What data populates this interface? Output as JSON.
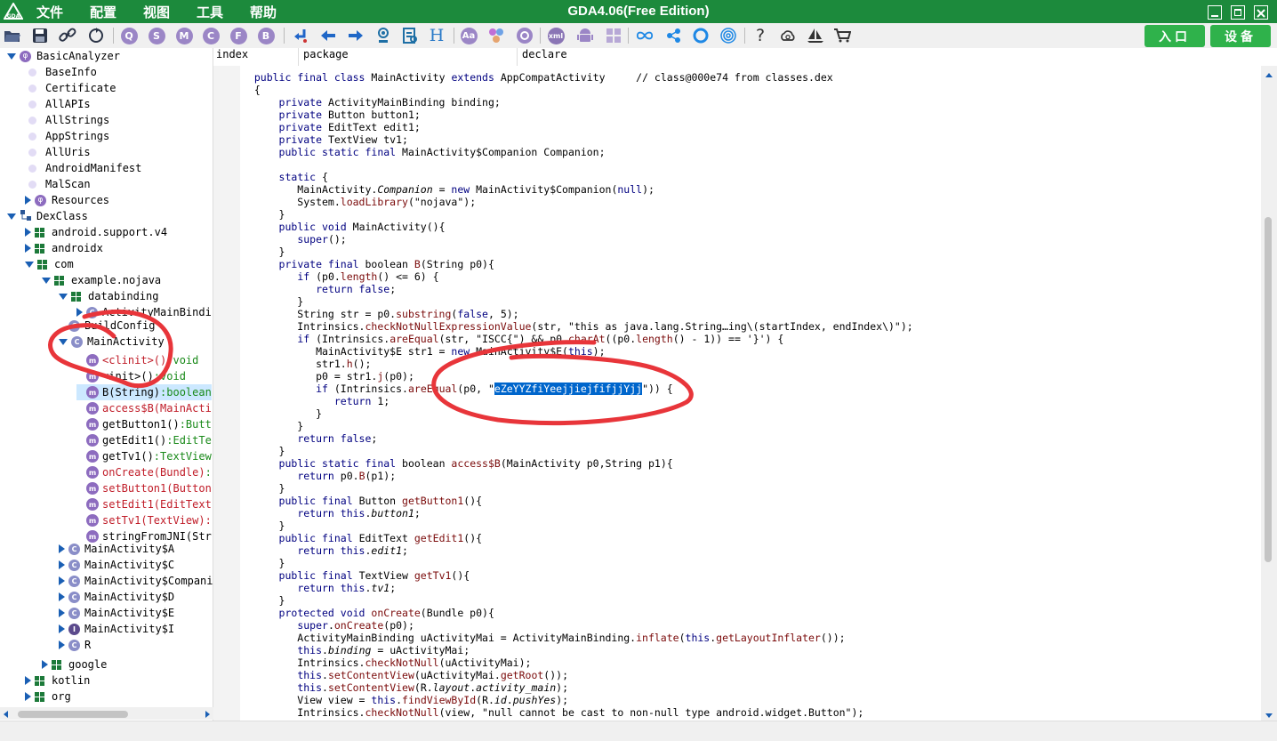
{
  "window": {
    "title": "GDA4.06(Free Edition)",
    "accent": "#1c8a3c"
  },
  "menu": [
    "文件",
    "配置",
    "视图",
    "工具",
    "帮助"
  ],
  "toolbar": {
    "circle_labels": [
      "Q",
      "S",
      "M",
      "C",
      "F",
      "B"
    ],
    "text_labels": [
      "H",
      "Aa",
      "xml",
      "?"
    ],
    "enter_button": "入口",
    "device_button": "设备",
    "button_color": "#2fb24b"
  },
  "tree": [
    {
      "label": "BasicAnalyzer",
      "icon": "analyzer-icon",
      "expander": "down",
      "depth": 0
    },
    {
      "label": "BaseInfo",
      "icon": "dot",
      "depth": 1
    },
    {
      "label": "Certificate",
      "icon": "dot",
      "depth": 1
    },
    {
      "label": "AllAPIs",
      "icon": "dot",
      "depth": 1
    },
    {
      "label": "AllStrings",
      "icon": "dot",
      "depth": 1
    },
    {
      "label": "AppStrings",
      "icon": "dot",
      "depth": 1
    },
    {
      "label": "AllUris",
      "icon": "dot",
      "depth": 1
    },
    {
      "label": "AndroidManifest",
      "icon": "dot",
      "depth": 1
    },
    {
      "label": "MalScan",
      "icon": "dot",
      "depth": 1
    },
    {
      "label": "Resources",
      "icon": "phi",
      "expander": "right",
      "depth": 1
    },
    {
      "label": "DexClass",
      "icon": "dex-icon",
      "expander": "down",
      "depth": 0
    },
    {
      "label": "android.support.v4",
      "icon": "pkg",
      "expander": "right",
      "depth": 1
    },
    {
      "label": "androidx",
      "icon": "pkg",
      "expander": "right",
      "depth": 1
    },
    {
      "label": "com",
      "icon": "pkg",
      "expander": "down",
      "depth": 1
    },
    {
      "label": "example.nojava",
      "icon": "pkg",
      "expander": "down",
      "depth": 2
    },
    {
      "label": "databinding",
      "icon": "pkg",
      "expander": "down",
      "depth": 3
    },
    {
      "label": "ActivityMainBindi",
      "icon": "class",
      "expander": "right",
      "depth": 4
    },
    {
      "label": "BuildConfig",
      "icon": "class",
      "depth": 3
    },
    {
      "label": "MainActivity",
      "icon": "class",
      "expander": "down",
      "depth": 3
    },
    {
      "label": "<clinit>()",
      "ret": ":void",
      "ret_color": "green",
      "icon": "method",
      "depth": 4
    },
    {
      "label": "<init>()",
      "ret": ":void",
      "ret_color": "green",
      "icon": "method",
      "depth": 4
    },
    {
      "label": "B(String)",
      "ret": ":boolean",
      "ret_color": "green",
      "icon": "method",
      "depth": 4,
      "selected": true
    },
    {
      "label": "access$B(MainActi",
      "ret": "",
      "ret_color": "red",
      "icon": "method",
      "depth": 4
    },
    {
      "label": "getButton1()",
      "ret": ":Butt",
      "ret_color": "green",
      "icon": "method",
      "depth": 4
    },
    {
      "label": "getEdit1()",
      "ret": ":EditTe",
      "ret_color": "green",
      "icon": "method",
      "depth": 4
    },
    {
      "label": "getTv1()",
      "ret": ":TextView",
      "ret_color": "green",
      "icon": "method",
      "depth": 4
    },
    {
      "label": "onCreate(Bundle)",
      "ret": ":",
      "ret_color": "green",
      "icon": "method",
      "depth": 4
    },
    {
      "label": "setButton1(Button",
      "ret": "",
      "ret_color": "red",
      "icon": "method",
      "depth": 4
    },
    {
      "label": "setEdit1(EditText",
      "ret": "",
      "ret_color": "red",
      "icon": "method",
      "depth": 4
    },
    {
      "label": "setTv1(TextView)",
      "ret": ":",
      "ret_color": "red",
      "icon": "method",
      "depth": 4
    },
    {
      "label": "stringFromJNI(Str",
      "ret": "",
      "ret_color": "green",
      "icon": "method",
      "depth": 4
    },
    {
      "label": "MainActivity$A",
      "icon": "class",
      "expander": "right",
      "depth": 3
    },
    {
      "label": "MainActivity$C",
      "icon": "class",
      "expander": "right",
      "depth": 3
    },
    {
      "label": "MainActivity$Compani",
      "icon": "class",
      "expander": "right",
      "depth": 3
    },
    {
      "label": "MainActivity$D",
      "icon": "class",
      "expander": "right",
      "depth": 3
    },
    {
      "label": "MainActivity$E",
      "icon": "class",
      "expander": "right",
      "depth": 3
    },
    {
      "label": "MainActivity$I",
      "icon": "interface",
      "expander": "right",
      "depth": 3
    },
    {
      "label": "R",
      "icon": "class",
      "expander": "right",
      "depth": 3
    },
    {
      "label": "google",
      "icon": "pkg",
      "expander": "right",
      "depth": 2
    },
    {
      "label": "kotlin",
      "icon": "pkg",
      "expander": "right",
      "depth": 1
    },
    {
      "label": "org",
      "icon": "pkg",
      "expander": "right",
      "depth": 1
    }
  ],
  "code_columns": [
    "index",
    "package",
    "declare"
  ],
  "code": [
    [
      [
        "  ",
        ""
      ],
      [
        "public final class ",
        "kw"
      ],
      [
        "MainActivity ",
        ""
      ],
      [
        "extends ",
        "kw"
      ],
      [
        "AppCompatActivity     // class@000e74 from classes.dex",
        ""
      ]
    ],
    [
      [
        "  {",
        ""
      ]
    ],
    [
      [
        "      ",
        ""
      ],
      [
        "private ",
        "kw"
      ],
      [
        "ActivityMainBinding binding;",
        ""
      ]
    ],
    [
      [
        "      ",
        ""
      ],
      [
        "private ",
        "kw"
      ],
      [
        "Button button1;",
        ""
      ]
    ],
    [
      [
        "      ",
        ""
      ],
      [
        "private ",
        "kw"
      ],
      [
        "EditText edit1;",
        ""
      ]
    ],
    [
      [
        "      ",
        ""
      ],
      [
        "private ",
        "kw"
      ],
      [
        "TextView tv1;",
        ""
      ]
    ],
    [
      [
        "      ",
        ""
      ],
      [
        "public static final ",
        "kw"
      ],
      [
        "MainActivity$Companion Companion;",
        ""
      ]
    ],
    [
      [
        "",
        ""
      ]
    ],
    [
      [
        "      ",
        ""
      ],
      [
        "static ",
        "kw"
      ],
      [
        "{",
        ""
      ]
    ],
    [
      [
        "         MainActivity.",
        ""
      ],
      [
        "Companion",
        "it"
      ],
      [
        " = ",
        ""
      ],
      [
        "new ",
        "kw"
      ],
      [
        "MainActivity$Companion(",
        ""
      ],
      [
        "null",
        "kw"
      ],
      [
        ");",
        ""
      ]
    ],
    [
      [
        "         System.",
        ""
      ],
      [
        "loadLibrary",
        "fn"
      ],
      [
        "(\"nojava\");",
        ""
      ]
    ],
    [
      [
        "      }",
        ""
      ]
    ],
    [
      [
        "      ",
        ""
      ],
      [
        "public void ",
        "kw"
      ],
      [
        "MainActivity(){",
        ""
      ]
    ],
    [
      [
        "         ",
        ""
      ],
      [
        "super",
        "kw"
      ],
      [
        "();",
        ""
      ]
    ],
    [
      [
        "      }",
        ""
      ]
    ],
    [
      [
        "      ",
        ""
      ],
      [
        "private final ",
        "kw"
      ],
      [
        "boolean ",
        ""
      ],
      [
        "B",
        "fn"
      ],
      [
        "(String p0){",
        ""
      ]
    ],
    [
      [
        "         ",
        ""
      ],
      [
        "if ",
        "kw"
      ],
      [
        "(p0.",
        ""
      ],
      [
        "length",
        "fn"
      ],
      [
        "() <= 6) {",
        ""
      ]
    ],
    [
      [
        "            ",
        ""
      ],
      [
        "return false",
        "kw"
      ],
      [
        ";",
        ""
      ]
    ],
    [
      [
        "         }",
        ""
      ]
    ],
    [
      [
        "         String str = p0.",
        ""
      ],
      [
        "substring",
        "fn"
      ],
      [
        "(",
        ""
      ],
      [
        "false",
        "kw"
      ],
      [
        ", 5);",
        ""
      ]
    ],
    [
      [
        "         Intrinsics.",
        ""
      ],
      [
        "checkNotNullExpressionValue",
        "fn"
      ],
      [
        "(str, \"this as java.lang.String…ing\\(startIndex, endIndex\\)\");",
        ""
      ]
    ],
    [
      [
        "         ",
        ""
      ],
      [
        "if ",
        "kw"
      ],
      [
        "(Intrinsics.",
        ""
      ],
      [
        "areEqual",
        "fn"
      ],
      [
        "(str, \"ISCC{\") && p0.",
        ""
      ],
      [
        "charAt",
        "fn"
      ],
      [
        "((p0.",
        ""
      ],
      [
        "length",
        "fn"
      ],
      [
        "() - 1)) == '}') {",
        ""
      ]
    ],
    [
      [
        "            MainActivity$E str1 = ",
        ""
      ],
      [
        "new ",
        "kw"
      ],
      [
        "MainActivity$E(",
        ""
      ],
      [
        "this",
        "kw"
      ],
      [
        ");",
        ""
      ]
    ],
    [
      [
        "            str1.",
        ""
      ],
      [
        "h",
        "fn"
      ],
      [
        "();",
        ""
      ]
    ],
    [
      [
        "            p0 = str1.",
        ""
      ],
      [
        "j",
        "fn"
      ],
      [
        "(p0);",
        ""
      ]
    ],
    [
      [
        "            ",
        ""
      ],
      [
        "if ",
        "kw"
      ],
      [
        "(Intrinsics.",
        ""
      ],
      [
        "areEqual",
        "fn"
      ],
      [
        "(p0, \"",
        ""
      ],
      [
        "eZeYYZfiYeejjiejfifjjYjj",
        "hl"
      ],
      [
        "\")) {",
        ""
      ]
    ],
    [
      [
        "               ",
        ""
      ],
      [
        "return ",
        "kw"
      ],
      [
        "1;",
        ""
      ]
    ],
    [
      [
        "            }",
        ""
      ]
    ],
    [
      [
        "         }",
        ""
      ]
    ],
    [
      [
        "         ",
        ""
      ],
      [
        "return false",
        "kw"
      ],
      [
        ";",
        ""
      ]
    ],
    [
      [
        "      }",
        ""
      ]
    ],
    [
      [
        "      ",
        ""
      ],
      [
        "public static final ",
        "kw"
      ],
      [
        "boolean ",
        ""
      ],
      [
        "access$B",
        "fn"
      ],
      [
        "(MainActivity p0,String p1){",
        ""
      ]
    ],
    [
      [
        "         ",
        ""
      ],
      [
        "return ",
        "kw"
      ],
      [
        "p0.",
        ""
      ],
      [
        "B",
        "fn"
      ],
      [
        "(p1);",
        ""
      ]
    ],
    [
      [
        "      }",
        ""
      ]
    ],
    [
      [
        "      ",
        ""
      ],
      [
        "public final ",
        "kw"
      ],
      [
        "Button ",
        ""
      ],
      [
        "getButton1",
        "fn"
      ],
      [
        "(){",
        ""
      ]
    ],
    [
      [
        "         ",
        ""
      ],
      [
        "return this",
        "kw"
      ],
      [
        ".",
        ""
      ],
      [
        "button1",
        "it"
      ],
      [
        ";",
        ""
      ]
    ],
    [
      [
        "      }",
        ""
      ]
    ],
    [
      [
        "      ",
        ""
      ],
      [
        "public final ",
        "kw"
      ],
      [
        "EditText ",
        ""
      ],
      [
        "getEdit1",
        "fn"
      ],
      [
        "(){",
        ""
      ]
    ],
    [
      [
        "         ",
        ""
      ],
      [
        "return this",
        "kw"
      ],
      [
        ".",
        ""
      ],
      [
        "edit1",
        "it"
      ],
      [
        ";",
        ""
      ]
    ],
    [
      [
        "      }",
        ""
      ]
    ],
    [
      [
        "      ",
        ""
      ],
      [
        "public final ",
        "kw"
      ],
      [
        "TextView ",
        ""
      ],
      [
        "getTv1",
        "fn"
      ],
      [
        "(){",
        ""
      ]
    ],
    [
      [
        "         ",
        ""
      ],
      [
        "return this",
        "kw"
      ],
      [
        ".",
        ""
      ],
      [
        "tv1",
        "it"
      ],
      [
        ";",
        ""
      ]
    ],
    [
      [
        "      }",
        ""
      ]
    ],
    [
      [
        "      ",
        ""
      ],
      [
        "protected void ",
        "kw"
      ],
      [
        "onCreate",
        "fn"
      ],
      [
        "(Bundle p0){",
        ""
      ]
    ],
    [
      [
        "         ",
        ""
      ],
      [
        "super",
        "kw"
      ],
      [
        ".",
        ""
      ],
      [
        "onCreate",
        "fn"
      ],
      [
        "(p0);",
        ""
      ]
    ],
    [
      [
        "         ActivityMainBinding uActivityMai = ActivityMainBinding.",
        ""
      ],
      [
        "inflate",
        "fn"
      ],
      [
        "(",
        ""
      ],
      [
        "this",
        "kw"
      ],
      [
        ".",
        ""
      ],
      [
        "getLayoutInflater",
        "fn"
      ],
      [
        "());",
        ""
      ]
    ],
    [
      [
        "         ",
        ""
      ],
      [
        "this",
        "kw"
      ],
      [
        ".",
        ""
      ],
      [
        "binding",
        "it"
      ],
      [
        " = uActivityMai;",
        ""
      ]
    ],
    [
      [
        "         Intrinsics.",
        ""
      ],
      [
        "checkNotNull",
        "fn"
      ],
      [
        "(uActivityMai);",
        ""
      ]
    ],
    [
      [
        "         ",
        ""
      ],
      [
        "this",
        "kw"
      ],
      [
        ".",
        ""
      ],
      [
        "setContentView",
        "fn"
      ],
      [
        "(uActivityMai.",
        ""
      ],
      [
        "getRoot",
        "fn"
      ],
      [
        "());",
        ""
      ]
    ],
    [
      [
        "         ",
        ""
      ],
      [
        "this",
        "kw"
      ],
      [
        ".",
        ""
      ],
      [
        "setContentView",
        "fn"
      ],
      [
        "(R.",
        ""
      ],
      [
        "layout",
        "it"
      ],
      [
        ".",
        ""
      ],
      [
        "activity_main",
        "it"
      ],
      [
        ");",
        ""
      ]
    ],
    [
      [
        "         View view = ",
        ""
      ],
      [
        "this",
        "kw"
      ],
      [
        ".",
        ""
      ],
      [
        "findViewById",
        "fn"
      ],
      [
        "(R.",
        ""
      ],
      [
        "id",
        "it"
      ],
      [
        ".",
        ""
      ],
      [
        "pushYes",
        "it"
      ],
      [
        ");",
        ""
      ]
    ],
    [
      [
        "         Intrinsics.",
        ""
      ],
      [
        "checkNotNull",
        "fn"
      ],
      [
        "(view, \"null cannot be cast to non-null type android.widget.Button\");",
        ""
      ]
    ]
  ]
}
